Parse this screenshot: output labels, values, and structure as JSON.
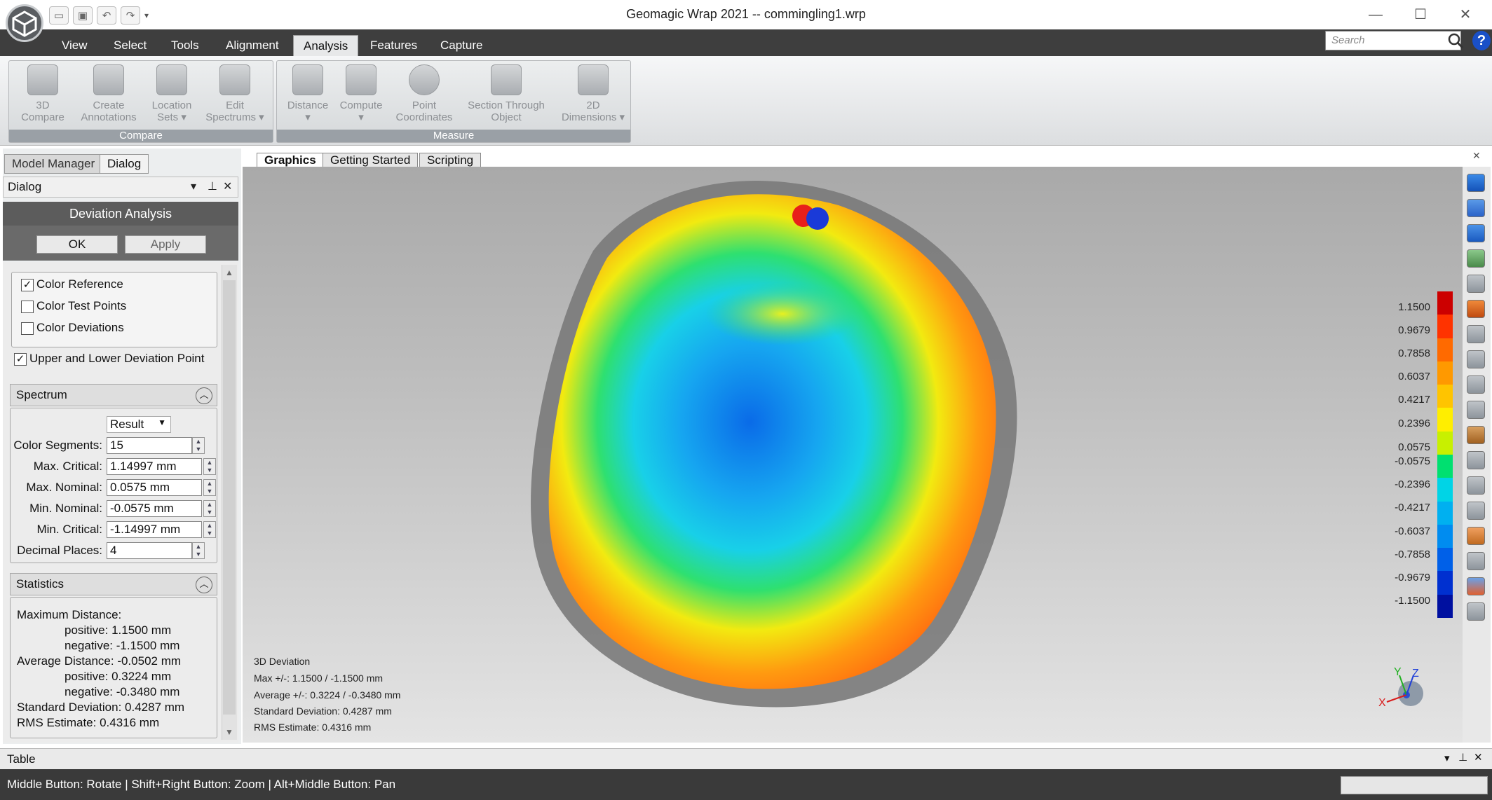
{
  "window": {
    "title": "Geomagic Wrap 2021 -- commingling1.wrp",
    "controls": [
      "minimize-icon",
      "maximize-icon",
      "close-icon"
    ]
  },
  "quick_access": [
    "new-icon",
    "save-icon",
    "undo-icon",
    "redo-icon",
    "dropdown-icon"
  ],
  "menu": [
    "View",
    "Select",
    "Tools",
    "Alignment",
    "Analysis",
    "Features",
    "Capture"
  ],
  "search": {
    "placeholder": "Search"
  },
  "ribbon": {
    "groups": [
      {
        "label": "Compare",
        "buttons": [
          {
            "label": "3D\nCompare"
          },
          {
            "label": "Create\nAnnotations"
          },
          {
            "label": "Location\nSets ▾"
          },
          {
            "label": "Edit\nSpectrums ▾"
          }
        ]
      },
      {
        "label": "Measure",
        "buttons": [
          {
            "label": "Distance\n▾"
          },
          {
            "label": "Compute\n▾"
          },
          {
            "label": "Point\nCoordinates"
          },
          {
            "label": "Section Through\nObject"
          },
          {
            "label": "2D\nDimensions ▾"
          }
        ]
      }
    ]
  },
  "panel_tabs": [
    "Model Manager",
    "Dialog"
  ],
  "dialog": {
    "header": "Dialog",
    "title": "Deviation Analysis",
    "ok": "OK",
    "apply": "Apply",
    "options": [
      {
        "label": "Color Reference",
        "checked": true
      },
      {
        "label": "Color Test Points",
        "checked": false
      },
      {
        "label": "Color Deviations",
        "checked": false
      }
    ],
    "upper_lower": {
      "label": "Upper and Lower Deviation Point",
      "checked": true
    },
    "spectrum": {
      "title": "Spectrum",
      "mode": "Result",
      "fields": [
        {
          "label": "Color Segments:",
          "value": "15"
        },
        {
          "label": "Max. Critical:",
          "value": "1.14997 mm"
        },
        {
          "label": "Max. Nominal:",
          "value": "0.0575 mm"
        },
        {
          "label": "Min. Nominal:",
          "value": "-0.0575 mm"
        },
        {
          "label": "Min. Critical:",
          "value": "-1.14997 mm"
        },
        {
          "label": "Decimal Places:",
          "value": "4"
        }
      ]
    },
    "statistics": {
      "title": "Statistics",
      "lines": [
        "Maximum Distance:",
        "positive: 1.1500 mm",
        "negative: -1.1500 mm",
        "Average Distance: -0.0502 mm",
        "positive: 0.3224 mm",
        "negative: -0.3480 mm",
        "Standard Deviation: 0.4287 mm",
        "RMS Estimate: 0.4316 mm"
      ]
    }
  },
  "view_tabs": [
    "Graphics",
    "Getting Started",
    "Scripting"
  ],
  "viewport_info": [
    "3D Deviation",
    "Max +/-: 1.1500 / -1.1500 mm",
    "Average +/-: 0.3224 / -0.3480 mm",
    "Standard Deviation: 0.4287 mm",
    "RMS Estimate: 0.4316 mm"
  ],
  "legend": [
    "1.1500",
    "0.9679",
    "0.7858",
    "0.6037",
    "0.4217",
    "0.2396",
    "0.0575",
    "-0.0575",
    "-0.2396",
    "-0.4217",
    "-0.6037",
    "-0.7858",
    "-0.9679",
    "-1.1500"
  ],
  "legend_colors": [
    "#cc0000",
    "#ff3300",
    "#ff6a00",
    "#ff9900",
    "#ffc400",
    "#ffee00",
    "#c8f000",
    "#00e070",
    "#00d4e6",
    "#00b0f0",
    "#008cf0",
    "#0060e8",
    "#0030d0",
    "#0010a0"
  ],
  "triad": {
    "x": "X",
    "y": "Y",
    "z": "Z"
  },
  "table_bar": {
    "label": "Table"
  },
  "status": {
    "text": "Middle Button: Rotate | Shift+Right Button: Zoom | Alt+Middle Button: Pan"
  }
}
